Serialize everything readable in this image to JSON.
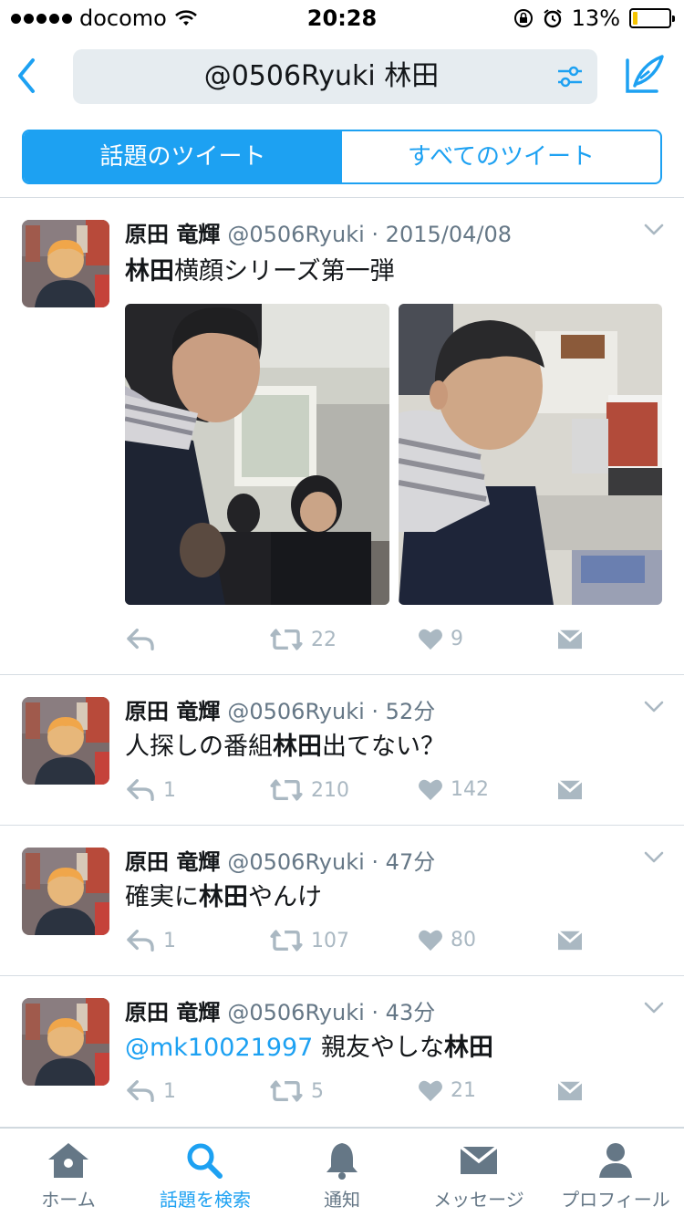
{
  "status_bar": {
    "carrier": "docomo",
    "time": "20:28",
    "battery": "13%",
    "battery_level": 0.13
  },
  "search": {
    "query": "@0506Ryuki  林田"
  },
  "segments": [
    {
      "label": "話題のツイート",
      "active": true
    },
    {
      "label": "すべてのツイート",
      "active": false
    }
  ],
  "tweets": [
    {
      "name": "原田 竜輝",
      "handle": "@0506Ryuki · 2015/04/08",
      "body_bold": "林田",
      "body_rest": "横顔シリーズ第一弾",
      "reply": "",
      "retweets": "22",
      "likes": "9"
    },
    {
      "name": "原田 竜輝",
      "handle": "@0506Ryuki · 52分",
      "body_pre": "人探しの番組",
      "body_bold": "林田",
      "body_rest": "出てない？",
      "reply": "1",
      "retweets": "210",
      "likes": "142"
    },
    {
      "name": "原田 竜輝",
      "handle": "@0506Ryuki · 47分",
      "body_pre": "確実に",
      "body_bold": "林田",
      "body_rest": "やんけ",
      "reply": "1",
      "retweets": "107",
      "likes": "80"
    },
    {
      "name": "原田 竜輝",
      "handle": "@0506Ryuki · 43分",
      "mention": "@mk10021997",
      "body_pre": " 親友やしな",
      "body_bold": "林田",
      "reply": "1",
      "retweets": "5",
      "likes": "21"
    }
  ],
  "tabs": [
    {
      "label": "ホーム",
      "icon": "home-icon"
    },
    {
      "label": "話題を検索",
      "icon": "search-icon",
      "active": true
    },
    {
      "label": "通知",
      "icon": "bell-icon"
    },
    {
      "label": "メッセージ",
      "icon": "envelope-icon"
    },
    {
      "label": "プロフィール",
      "icon": "profile-icon"
    }
  ],
  "colors": {
    "accent": "#1da1f2",
    "muted": "#aab8c2",
    "text": "#14171a",
    "secondary": "#657786"
  }
}
